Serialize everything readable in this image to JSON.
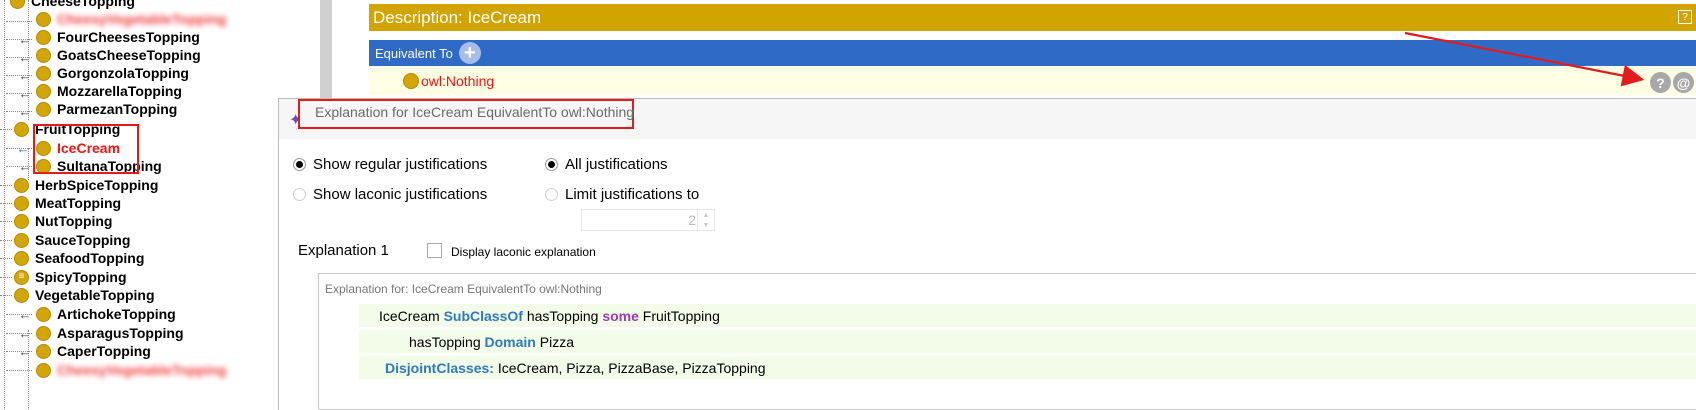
{
  "tree": {
    "items": [
      {
        "label": "CheeseTopping",
        "level": 1,
        "type": "class",
        "selected": false,
        "blurred": false
      },
      {
        "label": "CheesyVegetableTopping",
        "level": 2,
        "type": "class",
        "selected": false,
        "blurred": true
      },
      {
        "label": "FourCheesesTopping",
        "level": 2,
        "type": "class",
        "selected": false,
        "blurred": false
      },
      {
        "label": "GoatsCheeseTopping",
        "level": 2,
        "type": "class",
        "selected": false,
        "blurred": false
      },
      {
        "label": "GorgonzolaTopping",
        "level": 2,
        "type": "class",
        "selected": false,
        "blurred": false
      },
      {
        "label": "MozzarellaTopping",
        "level": 2,
        "type": "class",
        "selected": false,
        "blurred": false
      },
      {
        "label": "ParmezanTopping",
        "level": 2,
        "type": "class",
        "selected": false,
        "blurred": false
      },
      {
        "label": "FruitTopping",
        "level": 1,
        "type": "class",
        "selected": false,
        "blurred": false
      },
      {
        "label": "IceCream",
        "level": 2,
        "type": "class",
        "selected": true,
        "blurred": false
      },
      {
        "label": "SultanaTopping",
        "level": 2,
        "type": "class",
        "selected": false,
        "blurred": false
      },
      {
        "label": "HerbSpiceTopping",
        "level": 1,
        "type": "class",
        "selected": false,
        "blurred": false
      },
      {
        "label": "MeatTopping",
        "level": 1,
        "type": "class",
        "selected": false,
        "blurred": false
      },
      {
        "label": "NutTopping",
        "level": 1,
        "type": "class",
        "selected": false,
        "blurred": false
      },
      {
        "label": "SauceTopping",
        "level": 1,
        "type": "class",
        "selected": false,
        "blurred": false
      },
      {
        "label": "SeafoodTopping",
        "level": 1,
        "type": "class",
        "selected": false,
        "blurred": false
      },
      {
        "label": "SpicyTopping",
        "level": 1,
        "type": "defined-class",
        "selected": false,
        "blurred": false
      },
      {
        "label": "VegetableTopping",
        "level": 1,
        "type": "class",
        "selected": false,
        "blurred": false
      },
      {
        "label": "ArtichokeTopping",
        "level": 2,
        "type": "class",
        "selected": false,
        "blurred": false
      },
      {
        "label": "AsparagusTopping",
        "level": 2,
        "type": "class",
        "selected": false,
        "blurred": false
      },
      {
        "label": "CaperTopping",
        "level": 2,
        "type": "class",
        "selected": false,
        "blurred": false
      },
      {
        "label": "CheesyVegetableTopping",
        "level": 2,
        "type": "class",
        "selected": false,
        "blurred": true
      }
    ]
  },
  "description": {
    "title": "Description: IceCream",
    "help_icon": "question-square-icon",
    "equivalent_to_label": "Equivalent To",
    "add_icon": "plus-circle-icon",
    "equivalent_value": "owl:Nothing",
    "explain_button": "?",
    "annotate_button": "@"
  },
  "dialog": {
    "title": "Explanation for IceCream EquivalentTo owl:Nothing",
    "title_icon": "explanation-icon",
    "options": {
      "show_regular": "Show regular justifications",
      "show_laconic": "Show laconic justifications",
      "all_justifications": "All justifications",
      "limit_justifications": "Limit justifications to",
      "limit_value": "2"
    },
    "explanation_label": "Explanation 1",
    "display_laconic_label": "Display laconic explanation",
    "explanation_for": "Explanation for: IceCream EquivalentTo owl:Nothing",
    "axioms": [
      {
        "parts": [
          {
            "text": "IceCream ",
            "style": "plain"
          },
          {
            "text": "SubClassOf",
            "style": "blue"
          },
          {
            "text": " hasTopping ",
            "style": "plain"
          },
          {
            "text": "some",
            "style": "purple"
          },
          {
            "text": " FruitTopping",
            "style": "plain"
          }
        ]
      },
      {
        "parts": [
          {
            "text": "hasTopping ",
            "style": "plain"
          },
          {
            "text": "Domain",
            "style": "blue"
          },
          {
            "text": " Pizza",
            "style": "plain"
          }
        ]
      },
      {
        "parts": [
          {
            "text": "DisjointClasses:",
            "style": "blue"
          },
          {
            "text": " IceCream, Pizza, PizzaBase, PizzaTopping",
            "style": "plain"
          }
        ]
      }
    ]
  },
  "colors": {
    "class_dot": "#d4a605",
    "description_header": "#d2a400",
    "equivalent_header": "#2f6ac6",
    "keyword_blue": "#2f7ac0",
    "keyword_purple": "#a23ab4",
    "annotation_red": "#e31b1b",
    "selected_text": "#f01515"
  }
}
